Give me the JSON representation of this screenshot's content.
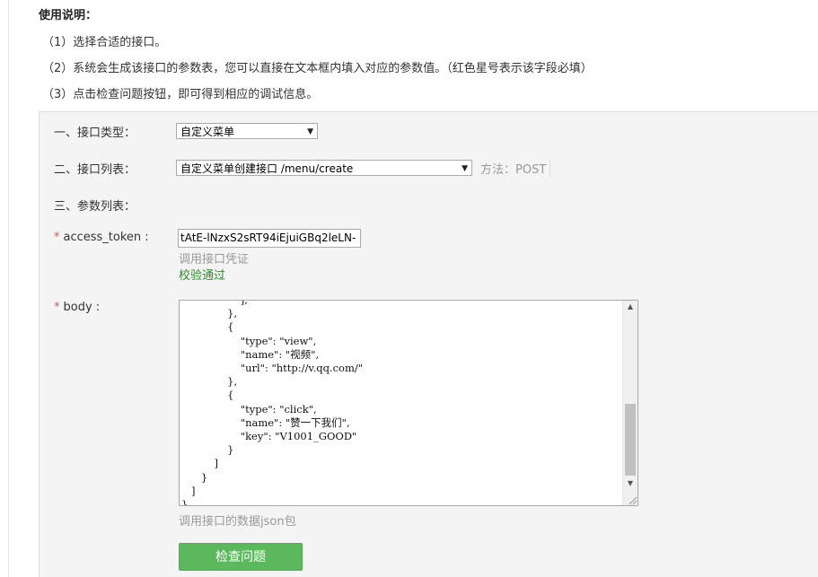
{
  "usage": {
    "title": "使用说明：",
    "lines": [
      "（1）选择合适的接口。",
      "（2）系统会生成该接口的参数表，您可以直接在文本框内填入对应的参数值。（红色星号表示该字段必填）",
      "（3）点击检查问题按钮，即可得到相应的调试信息。"
    ]
  },
  "form": {
    "interface_type_label": "一、接口类型：",
    "interface_type_value": "自定义菜单",
    "interface_list_label": "二、接口列表：",
    "interface_list_value": "自定义菜单创建接口 /menu/create",
    "method_text": "方法：POST",
    "params_label": "三、参数列表：",
    "required_mark": "*",
    "access_token": {
      "label": "access_token :",
      "value": "tAtE-lNzxS2sRT94iEjuiGBq2leLN-",
      "hint": "调用接口凭证",
      "validation": "校验通过"
    },
    "body": {
      "label": "body :",
      "content": "                  ],\n              },\n              {\n                  \"type\": \"view\",\n                  \"name\": \"视频\",\n                  \"url\": \"http://v.qq.com/\"\n              },\n              {\n                  \"type\": \"click\",\n                  \"name\": \"赞一下我们\",\n                  \"key\": \"V1001_GOOD\"\n              }\n          ]\n      }\n   ]\n}",
      "hint": "调用接口的数据json包"
    },
    "submit_label": "检查问题"
  },
  "colors": {
    "required": "#d9534f",
    "valid": "#2e8b2e",
    "button": "#5cb85c"
  },
  "icons": {
    "select_arrow": "triangle-down-icon",
    "scroll_up": "triangle-up-icon",
    "scroll_down": "triangle-down-icon",
    "resize": "resize-grip-icon"
  }
}
